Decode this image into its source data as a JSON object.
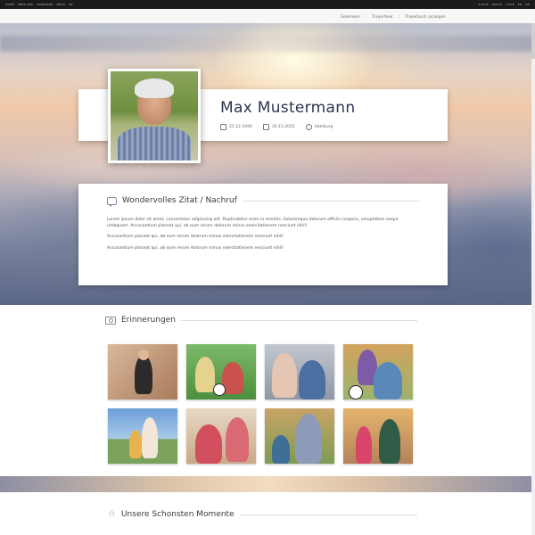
{
  "topbar": {
    "left": [
      "HOME",
      "ÜBER UNS",
      "GEDENKEN",
      "MEHR",
      "DE"
    ],
    "right": [
      "SUCHE",
      "KONTO",
      "HILFE",
      "EN",
      "DE"
    ]
  },
  "subnav": {
    "links": [
      "Gedenken",
      "Trauerfeier",
      "Trauerbuch anzeigen"
    ]
  },
  "profile": {
    "name": "Max Mustermann",
    "birth": "25.12.1946",
    "death": "10.11.2015",
    "place": "Hamburg"
  },
  "quote": {
    "title": "Wondervolles Zitat / Nachruf",
    "paragraphs": [
      "Lorem ipsum dolor sit amet, consectetur adipiscing elit. Duplicabitur enim in mentiis, doloremque dolorum officiis corporis, voluptatem saepe umbquam. Accusantium placeat qui, ab eum rerum dolorum minus exercitationem nesciunt nihil!",
      "Accusantium placeat qui, ab eum rerum dolorum minus exercitationem nesciunt nihil!",
      "Accusantium placeat qui, ab eum rerum dolorum minus exercitationem nesciunt nihil!"
    ]
  },
  "memories": {
    "title": "Erinnerungen",
    "photos": [
      {
        "alt": "Großvater mit Gitarre"
      },
      {
        "alt": "Großvater mit Kindern beim Fußball"
      },
      {
        "alt": "Großvater mit Enkel"
      },
      {
        "alt": "Enkel umarmt Großvater"
      },
      {
        "alt": "Großvater mit Kind im Freien"
      },
      {
        "alt": "Großeltern auf dem Sofa"
      },
      {
        "alt": "Großvater im Park"
      },
      {
        "alt": "Großvater mit Enkelin"
      }
    ]
  },
  "moments": {
    "title": "Unsere Schonsten Momente"
  },
  "icons": {
    "birth": "calendar-icon",
    "death": "calendar-icon",
    "place": "location-pin-icon",
    "quote": "chat-bubble-icon",
    "memories": "camera-icon",
    "moments": "star-icon"
  }
}
